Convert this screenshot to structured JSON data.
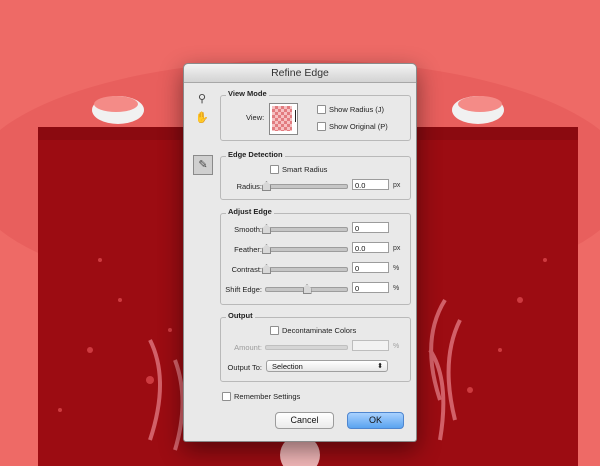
{
  "dialog": {
    "title": "Refine Edge"
  },
  "tools": {
    "zoom_glyph": "⚲",
    "hand_glyph": "✋",
    "brush_glyph": "✎"
  },
  "view_mode": {
    "legend": "View Mode",
    "view_label": "View:",
    "show_radius_label": "Show Radius (J)",
    "show_original_label": "Show Original (P)"
  },
  "edge_detection": {
    "legend": "Edge Detection",
    "smart_radius_label": "Smart Radius",
    "radius_label": "Radius:",
    "radius_value": "0.0",
    "radius_unit": "px",
    "radius_level": 0
  },
  "adjust_edge": {
    "legend": "Adjust Edge",
    "smooth_label": "Smooth:",
    "smooth_value": "0",
    "smooth_level": 0,
    "feather_label": "Feather:",
    "feather_value": "0.0",
    "feather_unit": "px",
    "feather_level": 0,
    "contrast_label": "Contrast:",
    "contrast_value": "0",
    "contrast_unit": "%",
    "contrast_level": 0,
    "shift_label": "Shift Edge:",
    "shift_value": "0",
    "shift_unit": "%",
    "shift_level": 0.5
  },
  "output": {
    "legend": "Output",
    "decontaminate_label": "Decontaminate Colors",
    "amount_label": "Amount:",
    "amount_value": "",
    "amount_unit": "%",
    "output_to_label": "Output To:",
    "output_to_value": "Selection",
    "dropdown_arrow": "⬍"
  },
  "footer": {
    "remember_label": "Remember Settings",
    "cancel_label": "Cancel",
    "ok_label": "OK"
  },
  "colors": {
    "background": "#ee6a66",
    "poster": "#9c0c12",
    "ok_button": "#5aa3f0"
  }
}
